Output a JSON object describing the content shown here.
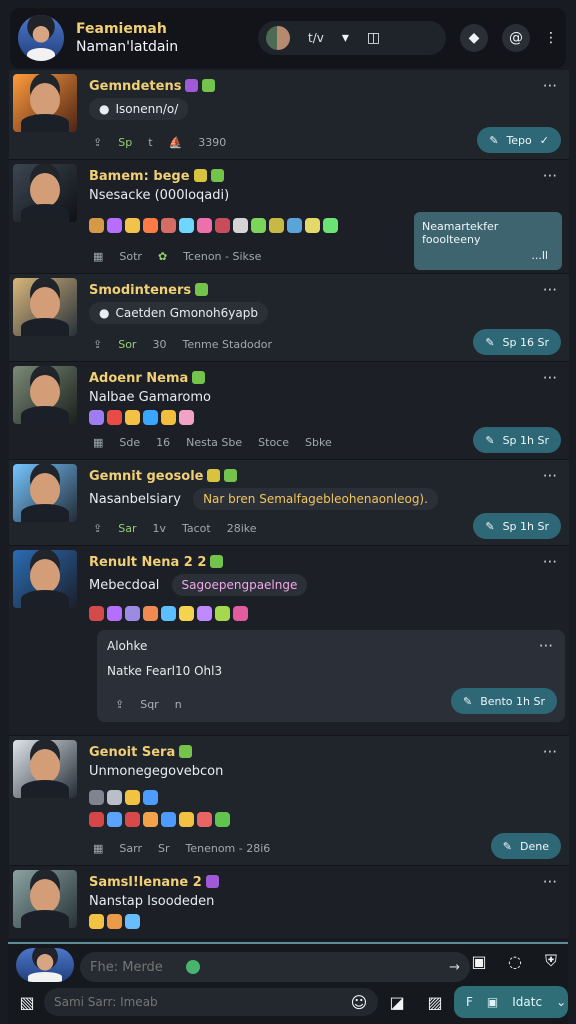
{
  "topbar": {
    "user_name": "Feamiemah",
    "subtitle": "Naman'latdain",
    "status": "t/v",
    "menu_icon": "more-vertical-icon"
  },
  "posts": [
    {
      "title": "Gemndetens",
      "subtitle_chip": "Isonenn/o/",
      "meta": [
        "Sp",
        "t",
        "3390"
      ],
      "action": "Tepo"
    },
    {
      "title": "Bamem: bege",
      "subtitle": "Nsesacke (000loqadi)",
      "meta": [
        "Sotr",
        "Tcenon - Sikse"
      ],
      "sidecard": "Neamartekfer fooolteeny",
      "sidecard_bottom": "...ll"
    },
    {
      "title": "Smodinteners",
      "subtitle_chip": "Caetden Gmonoh6yapb",
      "meta": [
        "Sor",
        "30",
        "Tenme Stadodor"
      ],
      "action": "Sp 16 Sr"
    },
    {
      "title": "Adoenr Nema",
      "subtitle": "Nalbae Gamaromo",
      "meta": [
        "Sde",
        "16",
        "Nesta Sbe",
        "Stoce",
        "Sbke"
      ],
      "action": "Sp 1h Sr"
    },
    {
      "title": "Gemnit geosole",
      "subtitle_chip": "Nasanbelsiary",
      "chip_right": "Nar bren Semalfagebleohenaonleog).",
      "meta": [
        "Sar",
        "1v",
        "Tacot",
        "28ike"
      ],
      "action": "Sp 1h Sr"
    },
    {
      "title": "Renult Nena 2 2",
      "subtitle_chip": "Mebecdoal",
      "chip_right": "Sagoepengpaelnge",
      "nested": {
        "row1": "Alohke",
        "row2": "Natke Fearl10 Ohl3",
        "meta": [
          "Sqr",
          "n"
        ],
        "action": "Bento 1h Sr"
      }
    },
    {
      "title": "Genoit Sera",
      "subtitle": "Unmonegegovebcon",
      "meta": [
        "Sarr",
        "Sr",
        "Tenenom - 28i6"
      ],
      "action": "Dene"
    },
    {
      "title": "Samsl!lenane 2",
      "subtitle": "Nanstap Isoodeden"
    }
  ],
  "composer": {
    "placeholder": "Fhe: Merde",
    "attach_icon": "attach-icon"
  },
  "bottom_search": {
    "placeholder": "Sami Sarr: Imeab"
  },
  "send_button": {
    "label": "Idatc"
  }
}
